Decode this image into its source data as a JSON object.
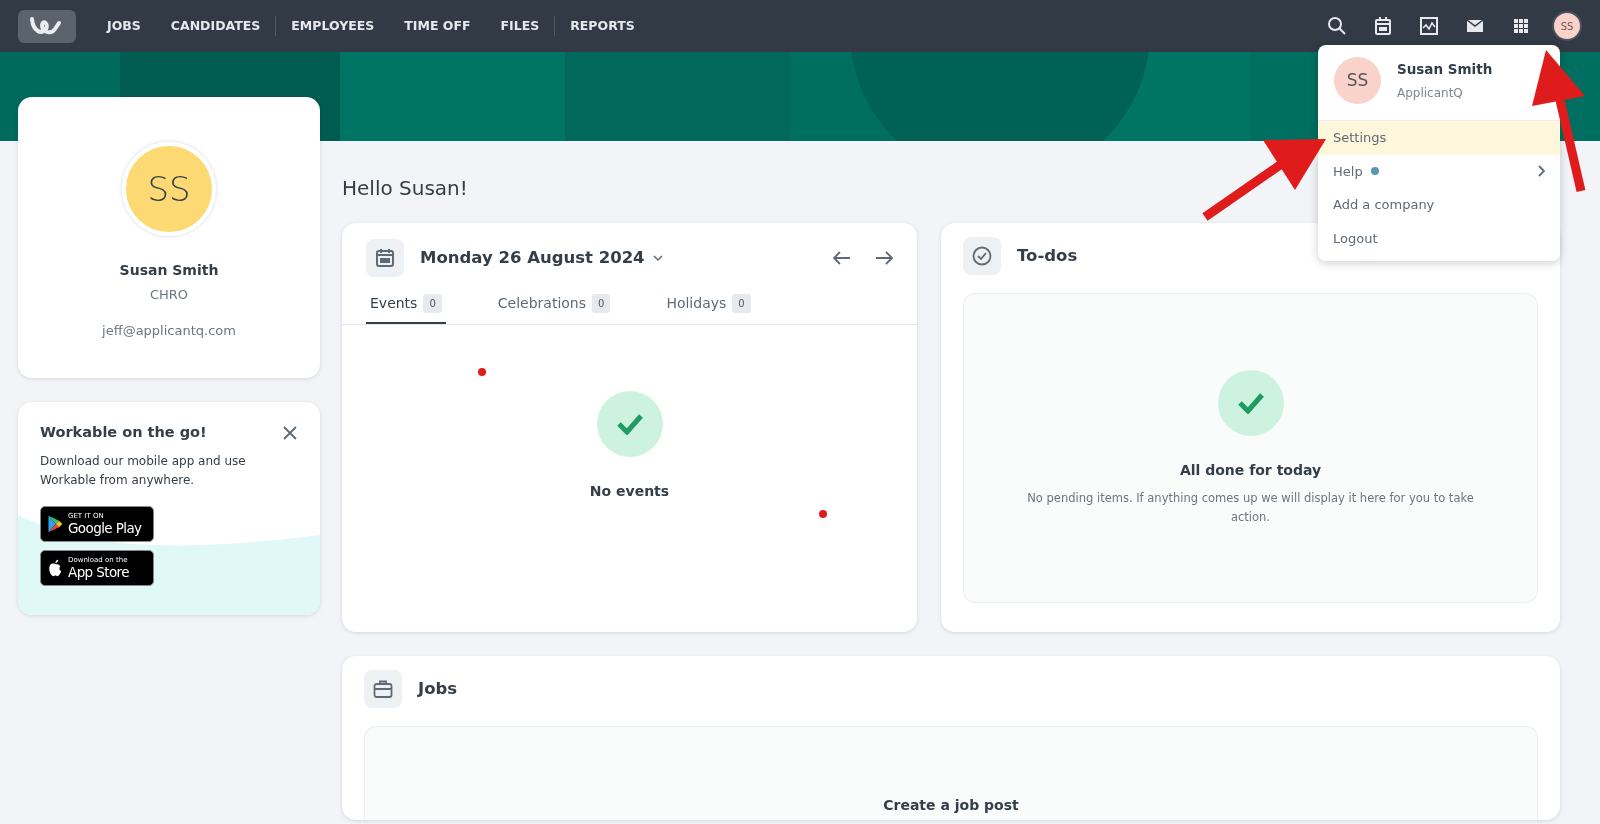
{
  "nav": {
    "items": [
      {
        "label": "JOBS",
        "divider_after": false
      },
      {
        "label": "CANDIDATES",
        "divider_after": true
      },
      {
        "label": "EMPLOYEES",
        "divider_after": false
      },
      {
        "label": "TIME OFF",
        "divider_after": false
      },
      {
        "label": "FILES",
        "divider_after": true
      },
      {
        "label": "REPORTS",
        "divider_after": false
      }
    ],
    "icons": [
      {
        "kind": "search"
      },
      {
        "kind": "calendar"
      },
      {
        "kind": "chart"
      },
      {
        "kind": "mail"
      },
      {
        "kind": "apps"
      }
    ],
    "avatar": "SS"
  },
  "user_menu": {
    "avatar": "SS",
    "name": "Susan Smith",
    "company": "ApplicantQ",
    "items": [
      {
        "label": "Settings",
        "selected": true,
        "dot": false,
        "submenu": false
      },
      {
        "label": "Help",
        "selected": false,
        "dot": true,
        "submenu": true
      },
      {
        "label": "Add a company",
        "selected": false,
        "dot": false,
        "submenu": false
      },
      {
        "label": "Logout",
        "selected": false,
        "dot": false,
        "submenu": false
      }
    ]
  },
  "profile": {
    "avatar": "SS",
    "name": "Susan Smith",
    "role": "CHRO",
    "email": "jeff@applicantq.com"
  },
  "app_promo": {
    "title": "Workable on the go!",
    "text": "Download our mobile app and use Workable from anywhere.",
    "badges": [
      {
        "kind": "google",
        "small": "GET IT ON",
        "big": "Google Play"
      },
      {
        "kind": "apple",
        "small": "Download on the",
        "big": "App Store"
      }
    ]
  },
  "greeting": "Hello Susan!",
  "calendar": {
    "date": "Monday 26 August 2024",
    "tabs": [
      {
        "label": "Events",
        "count": "0",
        "selected": true
      },
      {
        "label": "Celebrations",
        "count": "0",
        "selected": false
      },
      {
        "label": "Holidays",
        "count": "0",
        "selected": false
      }
    ],
    "empty": "No events"
  },
  "todos": {
    "title": "To-dos",
    "empty_title": "All done for today",
    "empty_text": "No pending items. If anything comes up we will display it here for you to take action."
  },
  "jobs": {
    "title": "Jobs",
    "empty_title": "Create a job post"
  }
}
